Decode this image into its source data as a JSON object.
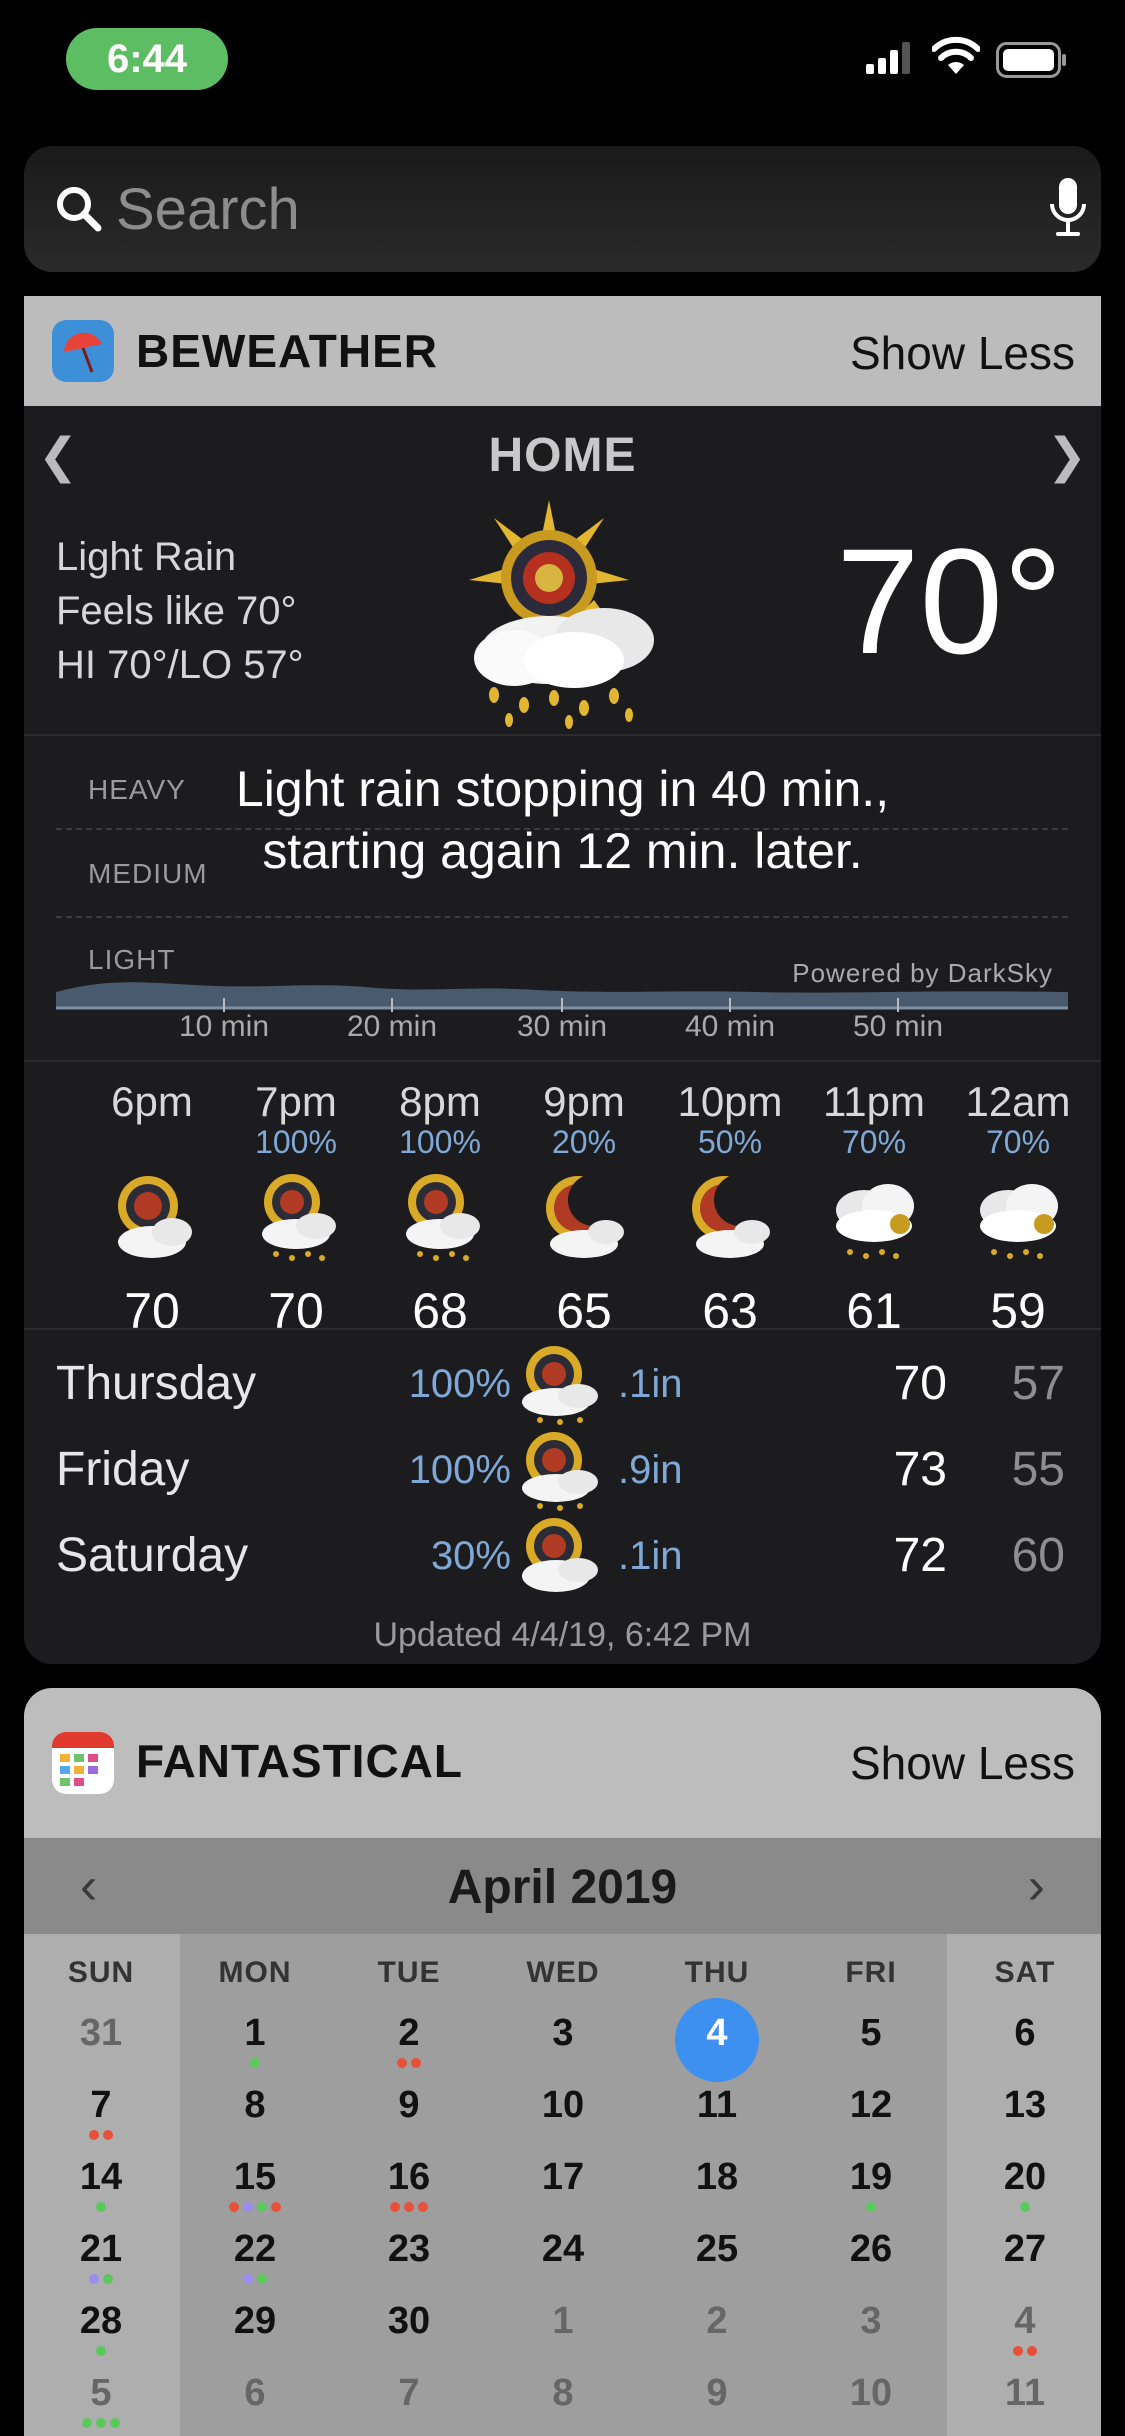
{
  "status": {
    "time": "6:44"
  },
  "search": {
    "placeholder": "Search"
  },
  "weather": {
    "app_name": "BEWEATHER",
    "show_less": "Show Less",
    "location": "HOME",
    "condition": "Light Rain",
    "feels_like": "Feels like 70°",
    "hi_lo": "HI 70°/LO 57°",
    "temperature": "70°",
    "levels": {
      "heavy": "HEAVY",
      "medium": "MEDIUM",
      "light": "LIGHT"
    },
    "rain_message_line1": "Light rain stopping in 40 min.,",
    "rain_message_line2": "starting again 12 min. later.",
    "powered_by": "Powered by DarkSky",
    "minute_ticks": [
      "10 min",
      "20 min",
      "30 min",
      "40 min",
      "50 min"
    ],
    "hourly": [
      {
        "hour": "6pm",
        "precip": "",
        "temp": "70",
        "icon": "sun-cloud-icon"
      },
      {
        "hour": "7pm",
        "precip": "100%",
        "temp": "70",
        "icon": "sun-rain-icon"
      },
      {
        "hour": "8pm",
        "precip": "100%",
        "temp": "68",
        "icon": "sun-rain-icon"
      },
      {
        "hour": "9pm",
        "precip": "20%",
        "temp": "65",
        "icon": "moon-cloud-icon"
      },
      {
        "hour": "10pm",
        "precip": "50%",
        "temp": "63",
        "icon": "moon-cloud-icon"
      },
      {
        "hour": "11pm",
        "precip": "70%",
        "temp": "61",
        "icon": "cloud-rain-icon"
      },
      {
        "hour": "12am",
        "precip": "70%",
        "temp": "59",
        "icon": "cloud-rain-icon"
      }
    ],
    "daily": [
      {
        "day": "Thursday",
        "precip": "100%",
        "amount": ".1in",
        "hi": "70",
        "lo": "57"
      },
      {
        "day": "Friday",
        "precip": "100%",
        "amount": ".9in",
        "hi": "73",
        "lo": "55"
      },
      {
        "day": "Saturday",
        "precip": "30%",
        "amount": ".1in",
        "hi": "72",
        "lo": "60"
      }
    ],
    "updated": "Updated 4/4/19, 6:42 PM"
  },
  "fantastical": {
    "app_name": "FANTASTICAL",
    "show_less": "Show Less",
    "month": "April 2019",
    "weekdays": [
      "SUN",
      "MON",
      "TUE",
      "WED",
      "THU",
      "FRI",
      "SAT"
    ],
    "weeks": [
      [
        "31",
        "1",
        "2",
        "3",
        "4",
        "5",
        "6"
      ],
      [
        "7",
        "8",
        "9",
        "10",
        "11",
        "12",
        "13"
      ],
      [
        "14",
        "15",
        "16",
        "17",
        "18",
        "19",
        "20"
      ],
      [
        "21",
        "22",
        "23",
        "24",
        "25",
        "26",
        "27"
      ],
      [
        "28",
        "29",
        "30",
        "1",
        "2",
        "3",
        "4"
      ],
      [
        "5",
        "6",
        "7",
        "8",
        "9",
        "10",
        "11"
      ]
    ],
    "today": "4",
    "colors": {
      "today": "#3d8ff0",
      "green": "#5ac85a",
      "red": "#e8503a",
      "purple": "#9b8cf0"
    }
  }
}
